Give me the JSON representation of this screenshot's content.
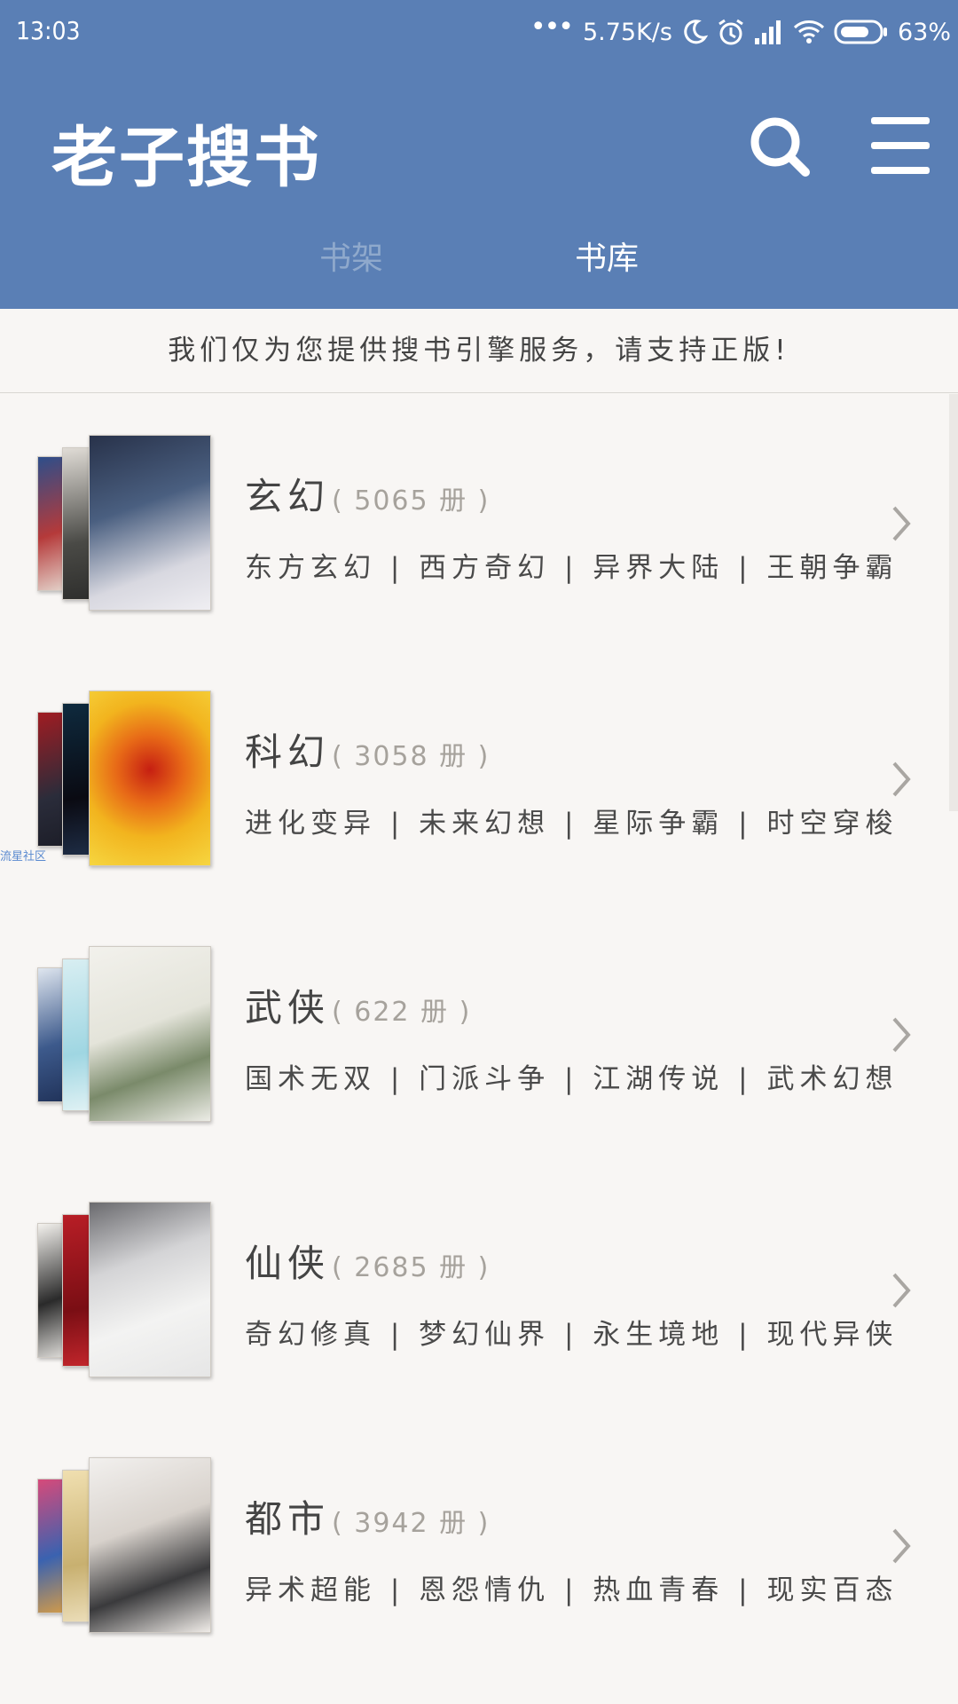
{
  "status_bar": {
    "time": "13:03",
    "network_speed": "5.75K/s",
    "battery": "63%",
    "icons": [
      "more-dots-icon",
      "moon-icon",
      "alarm-icon",
      "signal-icon",
      "wifi-icon",
      "battery-icon"
    ]
  },
  "header": {
    "title": "老子搜书",
    "search_icon": "search-icon",
    "menu_icon": "menu-icon",
    "tabs": [
      {
        "label": "书架",
        "active": false
      },
      {
        "label": "书库",
        "active": true
      }
    ]
  },
  "notice": "我们仅为您提供搜书引擎服务，请支持正版!",
  "categories": [
    {
      "name": "玄幻",
      "count": "( 5065 册 )",
      "tags": "东方玄幻 | 西方奇幻 | 异界大陆 | 王朝争霸"
    },
    {
      "name": "科幻",
      "count": "( 3058 册 )",
      "tags": "进化变异 | 未来幻想 | 星际争霸 | 时空穿梭"
    },
    {
      "name": "武侠",
      "count": "( 622 册 )",
      "tags": "国术无双 | 门派斗争 | 江湖传说 | 武术幻想"
    },
    {
      "name": "仙侠",
      "count": "( 2685 册 )",
      "tags": "奇幻修真 | 梦幻仙界 | 永生境地 | 现代异侠"
    },
    {
      "name": "都市",
      "count": "( 3942 册 )",
      "tags": "异术超能 | 恩怨情仇 | 热血青春 | 现实百态"
    }
  ],
  "watermark": "流星社区",
  "colors": {
    "header_bg": "#5a7fb5",
    "page_bg": "#f8f6f4",
    "tab_inactive": "#8fa9cc",
    "tab_active": "#ffffff"
  }
}
